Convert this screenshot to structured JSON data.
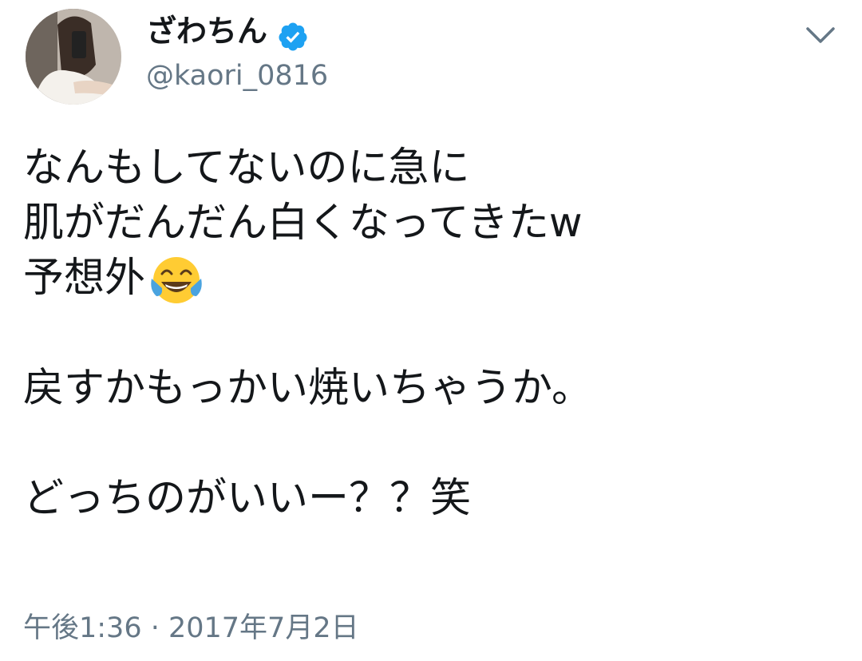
{
  "header": {
    "display_name": "ざわちん",
    "handle": "@kaori_0816",
    "verified": true,
    "verified_color": "#1da1f2"
  },
  "tweet": {
    "lines": [
      "なんもしてないのに急に",
      "肌がだんだん白くなってきたw",
      "予想外",
      "",
      "戻すかもっかい焼いちゃうか。",
      "",
      "どっちのがいいー？？笑"
    ],
    "emoji": "face-with-tears-of-joy-emoji"
  },
  "meta": {
    "timestamp": "午後1:36 · 2017年7月2日"
  },
  "colors": {
    "text": "#14171a",
    "secondary": "#657786",
    "accent": "#1da1f2"
  }
}
